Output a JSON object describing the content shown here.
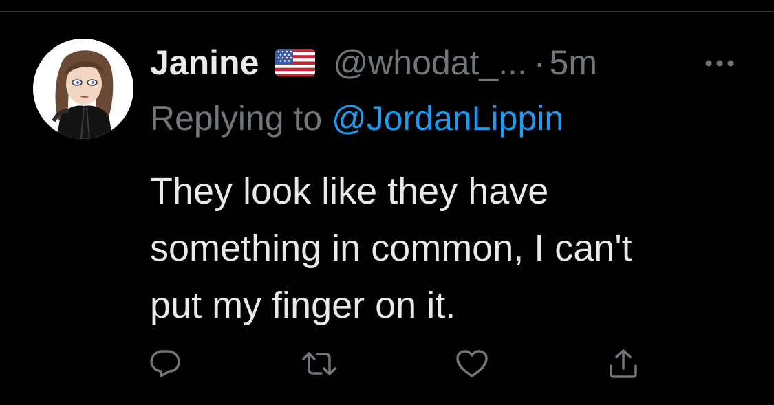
{
  "tweet": {
    "author": {
      "display_name": "Janine",
      "flag_icon": "us-flag-icon",
      "handle": "@whodat_...",
      "separator": "·",
      "time": "5m",
      "avatar_icon": "cartoon-woman-avatar"
    },
    "replying": {
      "label": "Replying to ",
      "target": "@JordanLippin"
    },
    "text": "They look like they have\nsomething in common, I can't\nput my finger on it.",
    "more_icon": "ellipsis-icon",
    "actions": [
      {
        "name": "reply",
        "icon": "reply-icon"
      },
      {
        "name": "retweet",
        "icon": "retweet-icon"
      },
      {
        "name": "like",
        "icon": "heart-icon"
      },
      {
        "name": "share",
        "icon": "share-icon"
      }
    ]
  },
  "colors": {
    "background": "#000000",
    "text_primary": "#e7e9ea",
    "text_secondary": "#71767b",
    "link": "#1d9bf0"
  }
}
